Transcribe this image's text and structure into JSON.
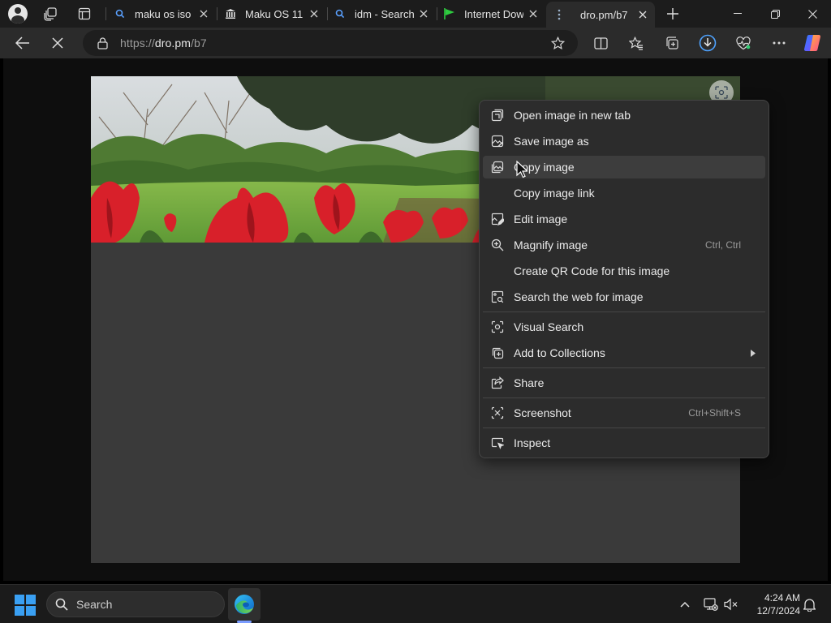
{
  "tabs": [
    {
      "title": "maku os iso -",
      "favicon": "search-favicon",
      "active": false
    },
    {
      "title": "Maku OS 11 :",
      "favicon": "bank-favicon",
      "active": false
    },
    {
      "title": "idm - Search",
      "favicon": "search-favicon",
      "active": false
    },
    {
      "title": "Internet Dow",
      "favicon": "green-flag-favicon",
      "active": false
    },
    {
      "title": "dro.pm/b7",
      "favicon": "dots-favicon",
      "active": true
    }
  ],
  "address": {
    "scheme": "https://",
    "host": "dro.pm",
    "path": "/b7"
  },
  "toolbar_icons": [
    "back-icon",
    "stop-icon",
    "lock-icon",
    "favorite-star-icon",
    "split-screen-icon",
    "favorites-icon",
    "collections-icon",
    "downloads-icon",
    "performance-icon",
    "more-icon",
    "copilot-icon"
  ],
  "context_menu": {
    "items": [
      {
        "label": "Open image in new tab",
        "icon": "open-new-tab-icon",
        "shortcut": ""
      },
      {
        "label": "Save image as",
        "icon": "save-image-icon",
        "shortcut": ""
      },
      {
        "label": "Copy image",
        "icon": "copy-image-icon",
        "shortcut": "",
        "hover": true
      },
      {
        "label": "Copy image link",
        "icon": "",
        "shortcut": ""
      },
      {
        "label": "Edit image",
        "icon": "edit-image-icon",
        "shortcut": ""
      },
      {
        "label": "Magnify image",
        "icon": "magnify-icon",
        "shortcut": "Ctrl, Ctrl"
      },
      {
        "label": "Create QR Code for this image",
        "icon": "",
        "shortcut": ""
      },
      {
        "label": "Search the web for image",
        "icon": "search-image-icon",
        "shortcut": ""
      },
      {
        "label": "Visual Search",
        "icon": "visual-search-icon",
        "shortcut": ""
      },
      {
        "label": "Add to Collections",
        "icon": "collections-add-icon",
        "shortcut": "",
        "submenu": true
      },
      {
        "label": "Share",
        "icon": "share-icon",
        "shortcut": ""
      },
      {
        "label": "Screenshot",
        "icon": "screenshot-icon",
        "shortcut": "Ctrl+Shift+S"
      },
      {
        "label": "Inspect",
        "icon": "inspect-icon",
        "shortcut": ""
      }
    ]
  },
  "taskbar": {
    "search_label": "Search",
    "time": "4:24 AM",
    "date": "12/7/2024"
  },
  "colors": {
    "tabstrip": "#1c1c1c",
    "toolbar": "#2b2b2b",
    "menu_bg": "#2c2c2c",
    "menu_hover": "#3d3d3d",
    "taskbar": "#1b1b1b",
    "windows_blue": "#3aa0f3"
  }
}
